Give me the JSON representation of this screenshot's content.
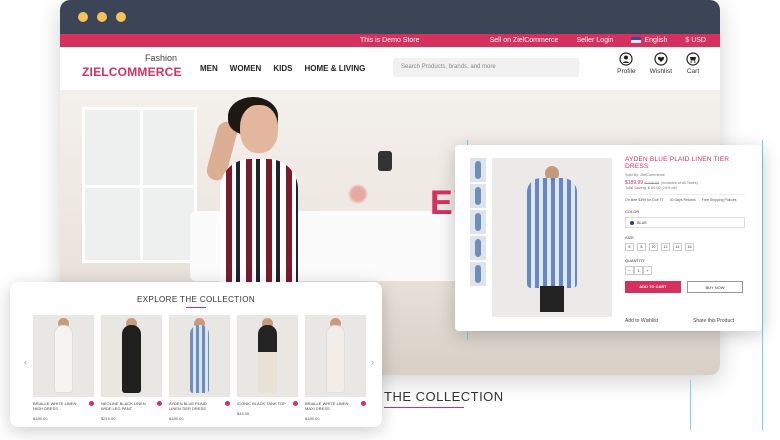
{
  "topbar": {
    "demo_text": "This is Demo Store",
    "sell_link": "Sell on ZielCommerce",
    "seller_login": "Seller Login",
    "language": "English",
    "currency": "$ USD"
  },
  "header": {
    "logo_tagline": "Fashion",
    "logo_name": "ZIELCOMMERCE",
    "nav": [
      "MEN",
      "WOMEN",
      "KIDS",
      "HOME & LIVING"
    ],
    "search_placeholder": "Search Products, brands, and more",
    "icons": [
      {
        "icon": "user-icon",
        "label": "Profile"
      },
      {
        "icon": "heart-icon",
        "label": "Wishlist"
      },
      {
        "icon": "cart-icon",
        "label": "Cart"
      }
    ]
  },
  "hero": {
    "partial_text": "EY",
    "section_title": "THE COLLECTION"
  },
  "collection_card": {
    "title": "EXPLORE THE COLLECTION",
    "prev": "‹",
    "next": "›",
    "products": [
      {
        "name": "BRIALLE WHITE LINEN HIGH DRESS",
        "price": "$189.00",
        "color": "#f4f2ee"
      },
      {
        "name": "NEOLINE BLACK LINEN WIDE LEG PANT",
        "price": "$219.00",
        "color": "#1f1f1f"
      },
      {
        "name": "AYDEN BLUE PLAID LINEN TIER DRESS",
        "price": "$189.00",
        "color": "#6d8ebc"
      },
      {
        "name": "ICONIC BLACK TANK TOP",
        "price": "$45.00",
        "color": "#242424"
      },
      {
        "name": "BRIALLE WHITE LINEN MAXI DRESS",
        "price": "$189.00",
        "color": "#f1eee9"
      }
    ]
  },
  "product_panel": {
    "title": "AYDEN BLUE PLAID LINEN TIER DRESS",
    "sold_by": "Sold By: ZielCommerce",
    "price": "$189.99",
    "old_price": "$ 249.99",
    "discount": "(Inclusive of all Taxes)",
    "saving": "Total Saving: $ 60.00 (24% off)",
    "perks": [
      "On time $399 for Golf TT",
      "30 Days Returns",
      "Free Shipping Policies"
    ],
    "color_label": "COLOR",
    "color_value": "BLUE",
    "size_label": "SIZE",
    "sizes": [
      "6",
      "8",
      "10",
      "12",
      "14",
      "16"
    ],
    "quantity_label": "QUANTITY",
    "qty_minus": "−",
    "qty_value": "1",
    "qty_plus": "+",
    "add_to_cart": "ADD TO CART",
    "buy_now": "BUY NOW",
    "wishlist": "Add to Wishlist",
    "share": "Share this Product"
  }
}
